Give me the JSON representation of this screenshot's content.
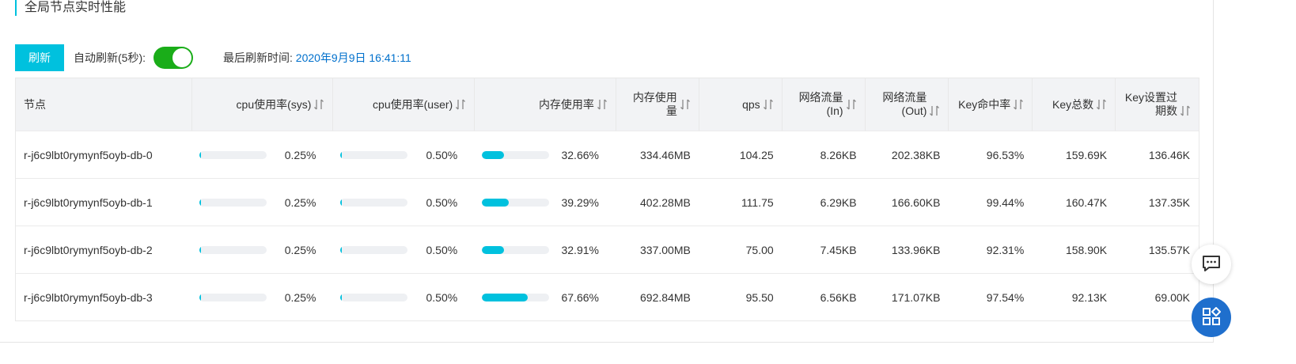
{
  "section": {
    "title": "全局节点实时性能"
  },
  "toolbar": {
    "refresh_label": "刷新",
    "auto_refresh_label": "自动刷新(5秒):",
    "auto_refresh_on": true,
    "last_refresh_label": "最后刷新时间:",
    "last_refresh_time": "2020年9月9日 16:41:11"
  },
  "table": {
    "columns": [
      {
        "line1": "节点",
        "line2": "",
        "sortable": false
      },
      {
        "line1": "cpu使用率(sys)",
        "line2": "",
        "sortable": true
      },
      {
        "line1": "cpu使用率(user)",
        "line2": "",
        "sortable": true
      },
      {
        "line1": "内存使用率",
        "line2": "",
        "sortable": true
      },
      {
        "line1": "内存使用量",
        "line2": "",
        "sortable": true
      },
      {
        "line1": "qps",
        "line2": "",
        "sortable": true
      },
      {
        "line1": "网络流量(In)",
        "line2": "",
        "sortable": true
      },
      {
        "line1": "网络流量",
        "line2": "(Out)",
        "sortable": true
      },
      {
        "line1": "Key命中率",
        "line2": "",
        "sortable": true
      },
      {
        "line1": "Key总数",
        "line2": "",
        "sortable": true
      },
      {
        "line1": "Key设置过",
        "line2": "期数",
        "sortable": true
      }
    ],
    "rows": [
      {
        "node": "r-j6c9lbt0rymynf5oyb-db-0",
        "cpu_sys": "0.25%",
        "cpu_sys_value": 0.25,
        "cpu_user": "0.50%",
        "cpu_user_value": 0.5,
        "mem_rate": "32.66%",
        "mem_rate_value": 32.66,
        "mem_used": "334.46MB",
        "qps": "104.25",
        "net_in": "8.26KB",
        "net_out": "202.38KB",
        "key_hit": "96.53%",
        "key_total": "159.69K",
        "key_expire": "136.46K"
      },
      {
        "node": "r-j6c9lbt0rymynf5oyb-db-1",
        "cpu_sys": "0.25%",
        "cpu_sys_value": 0.25,
        "cpu_user": "0.50%",
        "cpu_user_value": 0.5,
        "mem_rate": "39.29%",
        "mem_rate_value": 39.29,
        "mem_used": "402.28MB",
        "qps": "111.75",
        "net_in": "6.29KB",
        "net_out": "166.60KB",
        "key_hit": "99.44%",
        "key_total": "160.47K",
        "key_expire": "137.35K"
      },
      {
        "node": "r-j6c9lbt0rymynf5oyb-db-2",
        "cpu_sys": "0.25%",
        "cpu_sys_value": 0.25,
        "cpu_user": "0.50%",
        "cpu_user_value": 0.5,
        "mem_rate": "32.91%",
        "mem_rate_value": 32.91,
        "mem_used": "337.00MB",
        "qps": "75.00",
        "net_in": "7.45KB",
        "net_out": "133.96KB",
        "key_hit": "92.31%",
        "key_total": "158.90K",
        "key_expire": "135.57K"
      },
      {
        "node": "r-j6c9lbt0rymynf5oyb-db-3",
        "cpu_sys": "0.25%",
        "cpu_sys_value": 0.25,
        "cpu_user": "0.50%",
        "cpu_user_value": 0.5,
        "mem_rate": "67.66%",
        "mem_rate_value": 67.66,
        "mem_used": "692.84MB",
        "qps": "95.50",
        "net_in": "6.56KB",
        "net_out": "171.07KB",
        "key_hit": "97.54%",
        "key_total": "92.13K",
        "key_expire": "69.00K"
      }
    ]
  },
  "float_buttons": [
    {
      "icon": "chat-icon"
    },
    {
      "icon": "apps-icon"
    }
  ],
  "colors": {
    "accent": "#00c1de",
    "toggle_on": "#1aad19",
    "link": "#0070cc",
    "float_app": "#1f6fcd"
  }
}
